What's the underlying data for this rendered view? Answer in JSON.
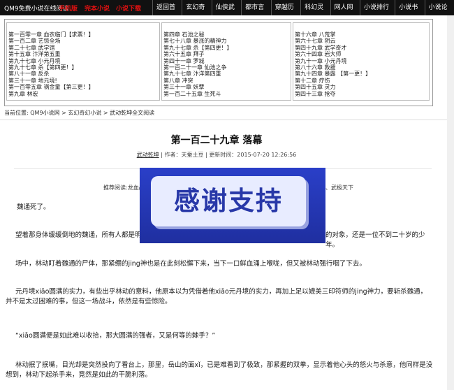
{
  "topbar": {
    "site_title": "QM9免费小说在线阅读",
    "links_red": [
      "手机版",
      "完本小说",
      "小说下载"
    ],
    "nav": [
      "返回首页",
      "玄幻奇幻",
      "仙侠武侠",
      "都市言情",
      "穿越历史",
      "科幻灵异",
      "网人网游",
      "小说排行榜",
      "小说书库",
      "小说论坛"
    ]
  },
  "chapter_panel": {
    "col1": [
      "第一百零一章 血衣临门【求票！】",
      "第一百二章 艺惊全场",
      "第二十七章 武学馆",
      "第十五章 汴洋第五重",
      "第九十七章 小元丹境",
      "第九十七章 杀【第四更！】",
      "第八十一章 反杀",
      "第三十一章 地元境!",
      "第一百零五章 祸金童【第三更！】",
      "第九章 林宏"
    ],
    "col2": [
      "第四章 石池之秘",
      "第七十八章 暴涨的精神力",
      "第九十七章 杀【第四更！】",
      "第六十五章 拜子",
      "第四十一章 罗城",
      "第一百二十一章 仙池之争",
      "第九十七章 汴洋第四重",
      "第八章 冲突",
      "第三十一章 妖孽",
      "第一百二十五章 生死斗"
    ],
    "col3": [
      "第十六章 八荒掌",
      "第六十七章 阴云",
      "第四十九章 武学奇才",
      "第六十四章 岩大师",
      "第九十一章 小元丹境",
      "第八十六章 救援",
      "第九十四章 暴露 【第一更！】",
      "第十二章 疗伤",
      "第四十五章 灵力",
      "第四十三章 抢夺"
    ]
  },
  "breadcrumb": {
    "label": "当前位置:",
    "items": [
      "QM9小说网",
      "玄幻奇幻小说",
      "武动乾坤全文阅读"
    ]
  },
  "chapter": {
    "title": "第一百二十九章 落幕",
    "book": "武动乾坤",
    "author": "作者：天蚕土豆",
    "updated": "更新时间：2015-07-20 12:26:56"
  },
  "recommend": {
    "left": "推荐阅读:龙血战神、混",
    "right": "、武极天下"
  },
  "paragraphs": [
    "魏通死了。",
    "望着那身体缓缓倒地的魏通，所有人都是明白",
    "的对象，还是一位不到二十岁的少年。",
    "场中，林动盯着魏通的尸体，那紧绷的jing神也是在此刻松懈下来，当下一口鲜血涌上喉咙，但又被林动强行咽了下去。",
    "元丹境xiǎo圆满的实力，有些出乎林动的意料，他原本以为凭借着他xiǎo元丹境的实力，再加上足以媲美三印符师的jing神力，要斩杀魏通，并不是太过困难的事，但这一场战斗，依然是有些惊险。",
    "“xiǎo圆满便是如此难以收拾，那大圆满的强者，又是何等的棘手？”",
    "林动抿了抿嘴，目光却是突然投向了看台上，那里，岳山的面xǐ，已是难看到了极致，那紧握的双拳，显示着他心头的怒火与杀意，他同样是没想到，林动下起杀手来，竟然是如此的干脆利落。"
  ],
  "banner": {
    "text": "感谢支持"
  }
}
